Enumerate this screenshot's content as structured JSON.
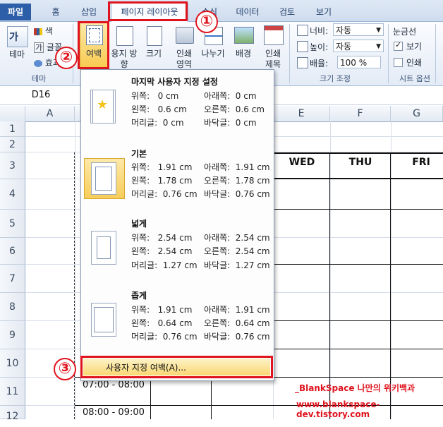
{
  "tabs": [
    "파일",
    "홈",
    "삽입",
    "페이지 레이아웃",
    "수식",
    "데이터",
    "검토",
    "보기"
  ],
  "ribbon": {
    "theme": {
      "themes_label": "테마",
      "colors_label": "색",
      "fonts_label": "글꼴",
      "effects_label": "효과",
      "group_label": "테마"
    },
    "page_setup": {
      "margins_label": "여백",
      "orientation_label": "용지 방향",
      "size_label": "크기",
      "print_area_label": "인쇄 영역",
      "breaks_label": "나누기",
      "background_label": "배경",
      "print_titles_label": "인쇄 제목"
    },
    "scale": {
      "width_label": "너비:",
      "width_value": "자동",
      "height_label": "높이:",
      "height_value": "자동",
      "scale_label": "배율:",
      "scale_value": "100 %",
      "group_label": "크기 조정"
    },
    "sheet_options": {
      "gridlines_label": "눈금선",
      "view_label": "보기",
      "print_label": "인쇄",
      "group_label": "시트 옵션"
    }
  },
  "name_box": "D16",
  "columns": [
    "A",
    "E",
    "F",
    "G"
  ],
  "rows": [
    "1",
    "2",
    "3",
    "4",
    "5",
    "6",
    "7",
    "8",
    "9",
    "10",
    "11",
    "12"
  ],
  "day_headers": [
    "WED",
    "THU",
    "FRI"
  ],
  "times": [
    "07:00 - 08:00",
    "08:00 - 09:00"
  ],
  "margins_menu": {
    "options": [
      {
        "name": "마지막 사용자 지정 설정",
        "top": "위쪽:   0 cm",
        "bottom": "아래쪽:  0 cm",
        "left": "왼쪽:   0.6 cm",
        "right": "오른쪽:  0.6 cm",
        "header": "머리글:  0 cm",
        "footer": "바닥글:  0 cm"
      },
      {
        "name": "기본",
        "top": "위쪽:   1.91 cm",
        "bottom": "아래쪽:  1.91 cm",
        "left": "왼쪽:   1.78 cm",
        "right": "오른쪽:  1.78 cm",
        "header": "머리글:  0.76 cm",
        "footer": "바닥글:  0.76 cm"
      },
      {
        "name": "넓게",
        "top": "위쪽:   2.54 cm",
        "bottom": "아래쪽:  2.54 cm",
        "left": "왼쪽:   2.54 cm",
        "right": "오른쪽:  2.54 cm",
        "header": "머리글:  1.27 cm",
        "footer": "바닥글:  1.27 cm"
      },
      {
        "name": "좁게",
        "top": "위쪽:   1.91 cm",
        "bottom": "아래쪽:  1.91 cm",
        "left": "왼쪽:   0.64 cm",
        "right": "오른쪽:  0.64 cm",
        "header": "머리글:  0.76 cm",
        "footer": "바닥글:  0.76 cm"
      }
    ],
    "custom_label": "사용자 지정 여백(A)..."
  },
  "callouts": [
    "①",
    "②",
    "③"
  ],
  "watermark": {
    "line1": "_BlankSpace 나만의 위키백과",
    "line2": "www.blankspace-dev.tistory.com"
  },
  "colors": {
    "accent": "#e0141e",
    "file_tab": "#2c5fa8"
  }
}
